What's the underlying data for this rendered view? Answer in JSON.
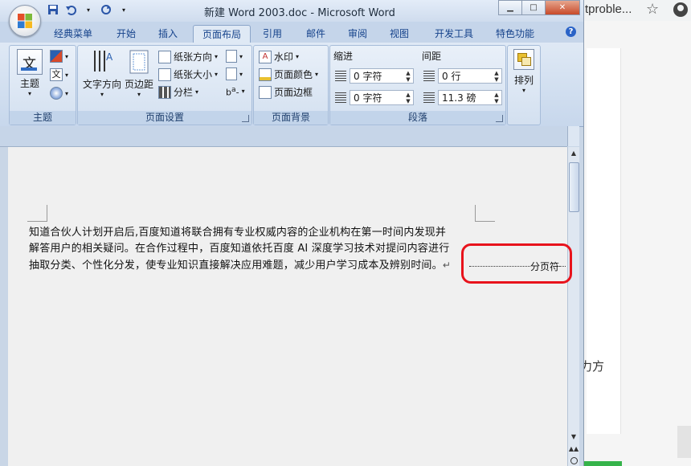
{
  "background_browser": {
    "tab_text": "tproble...",
    "partial_text": "力方",
    "star_icon": "star-icon",
    "account_icon": "account-icon"
  },
  "window": {
    "title": "新建 Word 2003.doc - Microsoft Word",
    "controls": {
      "minimize": "▁",
      "maximize": "□",
      "close": "✕"
    }
  },
  "quick_access": {
    "save_icon": "save-icon",
    "undo_icon": "undo-icon",
    "redo_icon": "redo-icon",
    "customize_icon": "dropdown-icon"
  },
  "tabs": [
    {
      "label": "经典菜单",
      "active": false
    },
    {
      "label": "开始",
      "active": false
    },
    {
      "label": "插入",
      "active": false
    },
    {
      "label": "页面布局",
      "active": true
    },
    {
      "label": "引用",
      "active": false
    },
    {
      "label": "邮件",
      "active": false
    },
    {
      "label": "审阅",
      "active": false
    },
    {
      "label": "视图",
      "active": false
    },
    {
      "label": "开发工具",
      "active": false
    },
    {
      "label": "特色功能",
      "active": false
    }
  ],
  "ribbon": {
    "theme_group": {
      "label": "主题",
      "theme_button": "主题",
      "theme_icon_text": "文",
      "fonts_icon_text": "文"
    },
    "page_setup": {
      "label": "页面设置",
      "text_direction": "文字方向",
      "margins": "页边距",
      "orientation": "纸张方向",
      "size": "纸张大小",
      "columns": "分栏"
    },
    "page_background": {
      "label": "页面背景",
      "watermark": "水印",
      "page_color": "页面颜色",
      "page_border": "页面边框"
    },
    "paragraph": {
      "label": "段落",
      "indent_label": "缩进",
      "spacing_label": "间距",
      "indent_left": "0 字符",
      "indent_right": "0 字符",
      "spacing_before": "0 行",
      "spacing_after": "11.3 磅"
    },
    "arrange": {
      "label": "排列"
    }
  },
  "document": {
    "lines": [
      "知道合伙人计划开启后,百度知道将联合拥有专业权威内容的企业机构在第一时间内发现并",
      "解答用户的相关疑问。在合作过程中，百度知道依托百度 AI 深度学习技术对提问内容进行",
      "抽取分类、个性化分发，使专业知识直接解决应用难题，减少用户学习成本及辨别时间。"
    ],
    "paragraph_mark": "↵",
    "page_break_label": "分页符"
  },
  "colors": {
    "highlight": "#e8131c",
    "tab_text": "#15428b",
    "ribbon": "#dfe9f5"
  }
}
